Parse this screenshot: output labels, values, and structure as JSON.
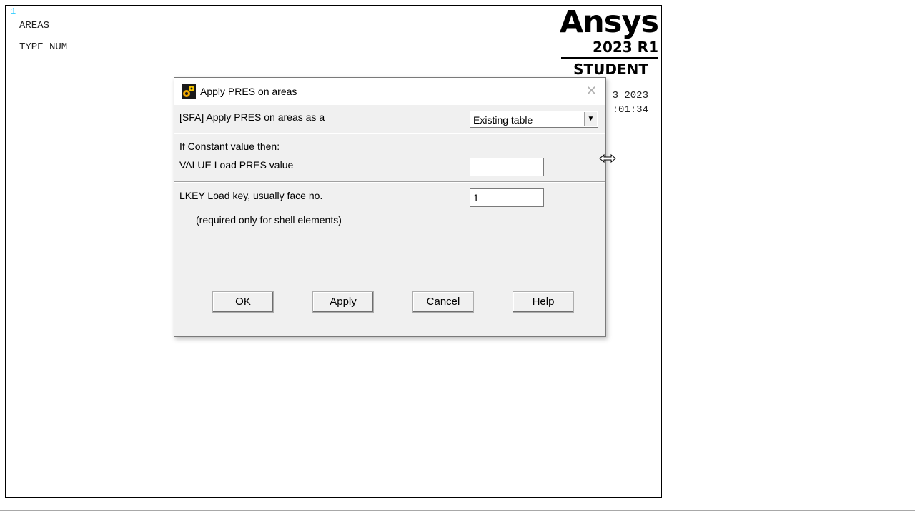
{
  "graphics": {
    "window_number": "1",
    "legend": [
      "AREAS",
      "TYPE NUM"
    ],
    "logo": {
      "name": "Ansys",
      "version": "2023 R1",
      "edition": "STUDENT"
    },
    "date_partial": "3 2023",
    "time_partial": ":01:34"
  },
  "dialog": {
    "title": "Apply PRES on areas",
    "icon": "ansys-gears-icon",
    "close_icon": "close-icon",
    "sfa_label": "[SFA] Apply PRES on areas as a",
    "sfa_selected": "Existing table",
    "constant_heading": "If Constant value then:",
    "value_label": "VALUE  Load PRES value",
    "value_input": "",
    "lkey_label": "LKEY  Load key, usually face no.",
    "lkey_input": "1",
    "lkey_note": "(required only for shell elements)",
    "buttons": {
      "ok": "OK",
      "apply": "Apply",
      "cancel": "Cancel",
      "help": "Help"
    }
  },
  "colors": {
    "window_number": "#33ccff",
    "dialog_bg": "#f0f0f0",
    "titlebar_bg": "#ffffff"
  },
  "cursor": "horizontal-resize-cursor-icon"
}
